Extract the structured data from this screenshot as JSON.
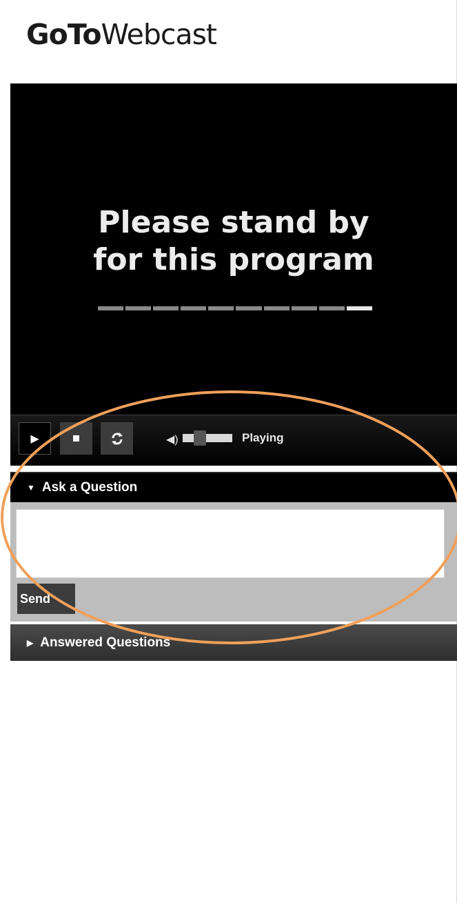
{
  "brand": {
    "bold": "GoTo",
    "light": "Webcast"
  },
  "video": {
    "standby_line1": "Please stand by",
    "standby_line2": "for this program",
    "progress_dash_count": 10,
    "progress_lit_index": 9
  },
  "controls": {
    "play_icon": "play-icon",
    "stop_icon": "stop-icon",
    "refresh_icon": "refresh-icon",
    "volume_icon": "volume-icon",
    "status": "Playing"
  },
  "ask": {
    "header": "Ask a Question",
    "input_value": "",
    "send_label": "Send"
  },
  "answered": {
    "header": "Answered Questions"
  },
  "colors": {
    "annotation_ring": "#f0a05a",
    "video_bg": "#000000",
    "panel_bg": "#bdbdbd"
  }
}
